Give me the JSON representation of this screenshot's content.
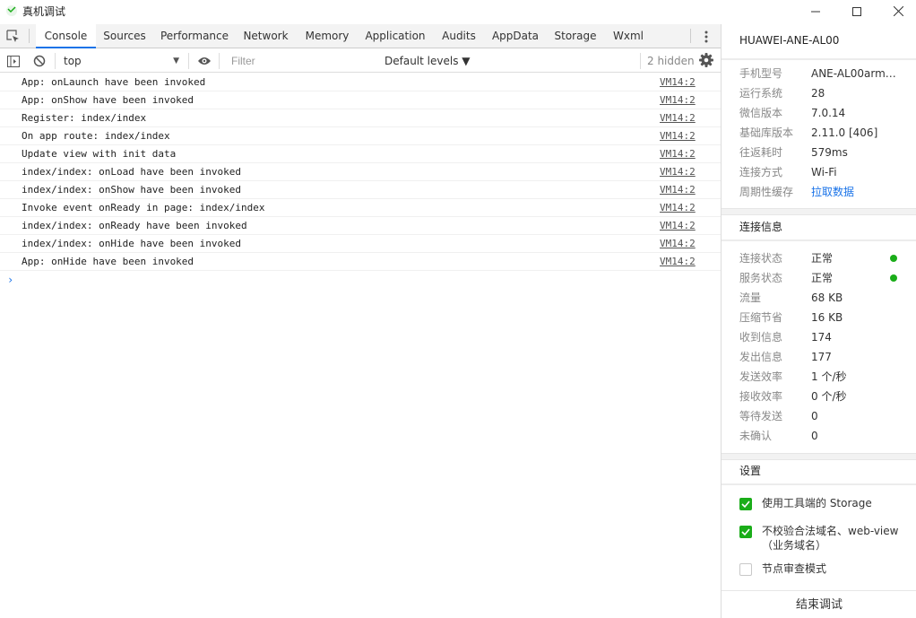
{
  "window": {
    "title": "真机调试",
    "accent": "#1a73e8",
    "ok_color": "#1aad19"
  },
  "devtools": {
    "tabs": [
      {
        "label": "Console"
      },
      {
        "label": "Sources"
      },
      {
        "label": "Performance"
      },
      {
        "label": "Network"
      },
      {
        "label": "Memory"
      },
      {
        "label": "Application"
      },
      {
        "label": "Audits"
      },
      {
        "label": "AppData"
      },
      {
        "label": "Storage"
      },
      {
        "label": "Wxml"
      }
    ],
    "active_tab": "Console",
    "filter": {
      "context": "top",
      "placeholder": "Filter",
      "levels": "Default levels ▼",
      "hidden": "2 hidden"
    },
    "logs": [
      {
        "message": "App: onLaunch have been invoked",
        "source": "VM14:2"
      },
      {
        "message": "App: onShow have been invoked",
        "source": "VM14:2"
      },
      {
        "message": "Register: index/index",
        "source": "VM14:2"
      },
      {
        "message": "On app route: index/index",
        "source": "VM14:2"
      },
      {
        "message": "Update view with init data",
        "source": "VM14:2"
      },
      {
        "message": "index/index: onLoad have been invoked",
        "source": "VM14:2"
      },
      {
        "message": "index/index: onShow have been invoked",
        "source": "VM14:2"
      },
      {
        "message": "Invoke event onReady in page: index/index",
        "source": "VM14:2"
      },
      {
        "message": "index/index: onReady have been invoked",
        "source": "VM14:2"
      },
      {
        "message": "index/index: onHide have been invoked",
        "source": "VM14:2"
      },
      {
        "message": "App: onHide have been invoked",
        "source": "VM14:2"
      }
    ],
    "prompt": "›"
  },
  "panel": {
    "device_name": "HUAWEI-ANE-AL00",
    "device_info": [
      {
        "key": "手机型号",
        "value": "ANE-AL00arm6..."
      },
      {
        "key": "运行系统",
        "value": "28"
      },
      {
        "key": "微信版本",
        "value": "7.0.14"
      },
      {
        "key": "基础库版本",
        "value": "2.11.0 [406]"
      },
      {
        "key": "往返耗时",
        "value": "579ms"
      },
      {
        "key": "连接方式",
        "value": "Wi-Fi"
      },
      {
        "key": "周期性缓存",
        "value": "拉取数据"
      }
    ],
    "connection_title": "连接信息",
    "connection_info": [
      {
        "key": "连接状态",
        "value": "正常"
      },
      {
        "key": "服务状态",
        "value": "正常"
      },
      {
        "key": "流量",
        "value": "68 KB"
      },
      {
        "key": "压缩节省",
        "value": "16 KB"
      },
      {
        "key": "收到信息",
        "value": "174"
      },
      {
        "key": "发出信息",
        "value": "177"
      },
      {
        "key": "发送效率",
        "value": "1 个/秒"
      },
      {
        "key": "接收效率",
        "value": "0 个/秒"
      },
      {
        "key": "等待发送",
        "value": "0"
      },
      {
        "key": "未确认",
        "value": "0"
      }
    ],
    "settings_title": "设置",
    "settings": [
      {
        "label": "使用工具端的 Storage",
        "checked": true
      },
      {
        "label": "不校验合法域名、web-view（业务域名）",
        "checked": true
      },
      {
        "label": "节点审查模式",
        "checked": false
      }
    ],
    "end_button": "结束调试"
  }
}
